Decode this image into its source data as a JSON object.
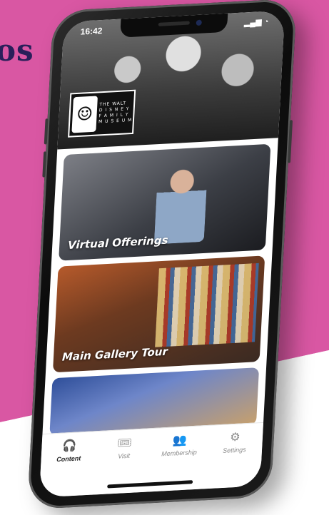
{
  "headline": "os",
  "status_bar": {
    "time": "16:42",
    "signal": "▂▄▆",
    "wifi": "◔"
  },
  "hero": {
    "logo_glyph": "☺",
    "logo_lines": [
      "THE WALT",
      "D I S N E Y",
      "F A M I L Y",
      "M U S E U M"
    ]
  },
  "cards": [
    {
      "label": "Virtual Offerings"
    },
    {
      "label": "Main Gallery Tour"
    },
    {
      "label": ""
    }
  ],
  "tabbar": {
    "tabs": [
      {
        "label": "Content",
        "icon": "🎧",
        "active": true
      },
      {
        "label": "Visit",
        "icon": "🎟",
        "active": false
      },
      {
        "label": "Membership",
        "icon": "👥",
        "active": false
      },
      {
        "label": "Settings",
        "icon": "⚙",
        "active": false
      }
    ]
  },
  "colors": {
    "pink": "#d957a3",
    "headline": "#2a1f5a"
  }
}
